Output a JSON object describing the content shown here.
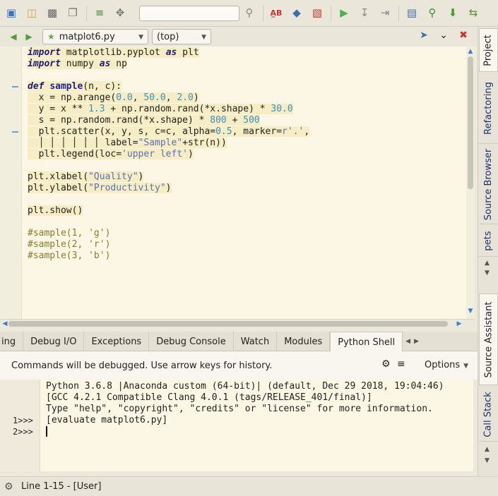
{
  "toolbar": {
    "search_value": "",
    "icons": [
      "new-file-icon",
      "open-folder-icon",
      "save-icon",
      "save-all-icon",
      "indent-icon",
      "goto-icon",
      "search-icon",
      "spellcheck-icon",
      "python-icon",
      "run-config-icon",
      "debug-run-icon",
      "step-icon",
      "step-into-icon",
      "display-icon",
      "find-icon",
      "download-icon",
      "sync-icon"
    ]
  },
  "editor_nav": {
    "file": "matplot6.py",
    "scope": "(top)"
  },
  "code_lines": [
    [
      [
        "kw",
        "import"
      ],
      [
        "id",
        " matplotlib.pyplot "
      ],
      [
        "kw",
        "as"
      ],
      [
        "id",
        " plt"
      ]
    ],
    [
      [
        "kw",
        "import"
      ],
      [
        "id",
        " numpy "
      ],
      [
        "kw",
        "as"
      ],
      [
        "id",
        " np"
      ]
    ],
    [],
    [
      [
        "kw",
        "def"
      ],
      [
        "id",
        " "
      ],
      [
        "fn",
        "sample"
      ],
      [
        "id",
        "(n, c):"
      ]
    ],
    [
      [
        "id",
        "  x = np.arange("
      ],
      [
        "nm",
        "0.0"
      ],
      [
        "id",
        ", "
      ],
      [
        "nm",
        "50.0"
      ],
      [
        "id",
        ", "
      ],
      [
        "nm",
        "2.0"
      ],
      [
        "id",
        ")"
      ]
    ],
    [
      [
        "id",
        "  y = x ** "
      ],
      [
        "nm",
        "1.3"
      ],
      [
        "id",
        " + np.random.rand(*x.shape) * "
      ],
      [
        "nm",
        "30.0"
      ]
    ],
    [
      [
        "id",
        "  s = np.random.rand(*x.shape) * "
      ],
      [
        "nm",
        "800"
      ],
      [
        "id",
        " + "
      ],
      [
        "nm",
        "500"
      ]
    ],
    [
      [
        "id",
        "  plt.scatter(x, y, s, c=c, alpha="
      ],
      [
        "nm",
        "0.5"
      ],
      [
        "id",
        ", marker="
      ],
      [
        "st",
        "r'.'"
      ],
      [
        "id",
        ","
      ]
    ],
    [
      [
        "id",
        "  │ │ │ │ │ │ label="
      ],
      [
        "st",
        "\"Sample\""
      ],
      [
        "id",
        "+str(n))"
      ]
    ],
    [
      [
        "id",
        "  plt.legend(loc="
      ],
      [
        "st",
        "'upper left'"
      ],
      [
        "id",
        ")"
      ]
    ],
    [],
    [
      [
        "id",
        "plt.xlabel("
      ],
      [
        "st",
        "\"Quality\""
      ],
      [
        "id",
        ")"
      ]
    ],
    [
      [
        "id",
        "plt.ylabel("
      ],
      [
        "st",
        "\"Productivity\""
      ],
      [
        "id",
        ")"
      ]
    ],
    [],
    [
      [
        "id",
        "plt.show()"
      ]
    ],
    [],
    [
      [
        "cm",
        "#sample(1, 'g')"
      ]
    ],
    [
      [
        "cm",
        "#sample(2, 'r')"
      ]
    ],
    [
      [
        "cm",
        "#sample(3, 'b')"
      ]
    ]
  ],
  "right_tabs": [
    "Project",
    "Refactoring",
    "Source Browser",
    "pets",
    "Source Assistant",
    "Call Stack"
  ],
  "tool_tabs": [
    "ing",
    "Debug I/O",
    "Exceptions",
    "Debug Console",
    "Watch",
    "Modules",
    "Python Shell"
  ],
  "active_tool_tab": "Python Shell",
  "shell": {
    "note": "Commands will be debugged.  Use arrow keys for history.",
    "options_label": "Options",
    "prompts": [
      "1>>>",
      "2>>>"
    ],
    "output": [
      "Python 3.6.8 |Anaconda custom (64-bit)| (default, Dec 29 2018, 19:04:46)",
      "[GCC 4.2.1 Compatible Clang 4.0.1 (tags/RELEASE_401/final)]",
      "Type \"help\", \"copyright\", \"credits\" or \"license\" for more information.",
      "[evaluate matplot6.py]"
    ]
  },
  "status": {
    "text": "Line 1-15 - [User]"
  }
}
